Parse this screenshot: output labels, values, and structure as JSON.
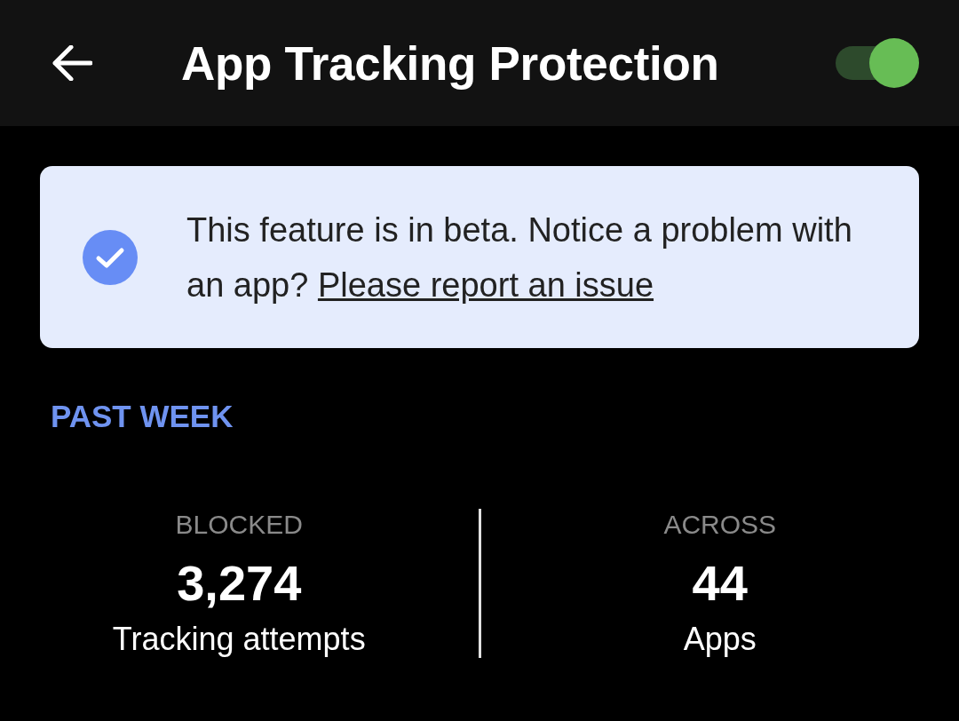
{
  "app_bar": {
    "title": "App Tracking Protection",
    "toggle": {
      "on": true
    }
  },
  "notice": {
    "text": "This feature is in beta. Notice a problem with an app?",
    "link": "Please report an issue"
  },
  "section": {
    "title": "PAST WEEK"
  },
  "stats": [
    {
      "label": "BLOCKED",
      "value": "3,274",
      "caption": "Tracking attempts"
    },
    {
      "label": "ACROSS",
      "value": "44",
      "caption": "Apps"
    }
  ]
}
